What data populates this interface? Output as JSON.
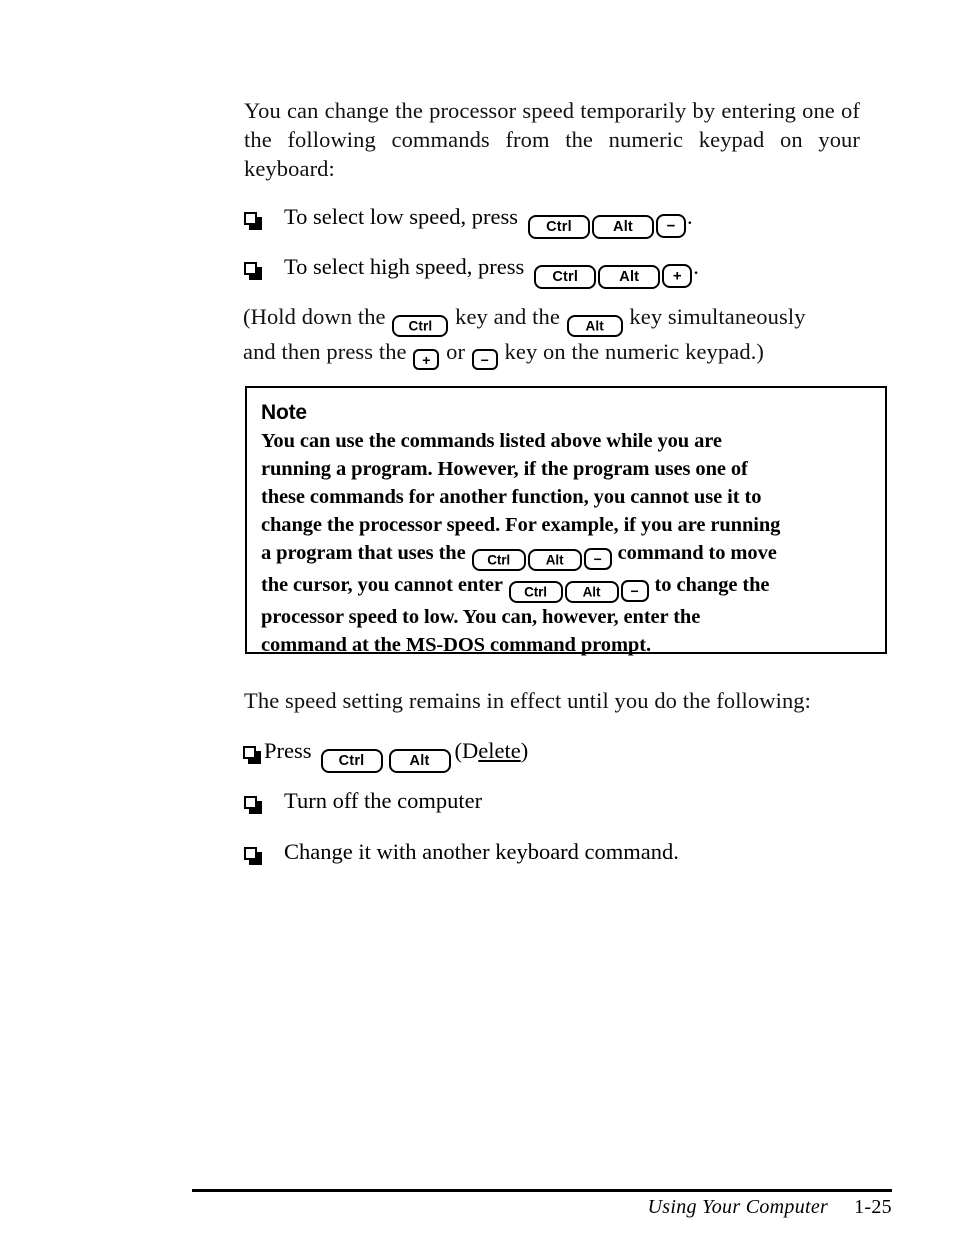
{
  "document": {
    "intro_paragraph": "You can change the processor speed temporarily by entering one of the following commands from the numeric keypad on your keyboard:",
    "speed_bullets": [
      {
        "bullet_glyph": "square-bullet",
        "text_before": "To select low speed, press",
        "keys": [
          "Ctrl",
          "Alt",
          "−"
        ],
        "text_after": "."
      },
      {
        "bullet_glyph": "square-bullet",
        "text_before": "To select high speed, press",
        "keys": [
          "Ctrl",
          "Alt",
          "+"
        ],
        "text_after": "."
      }
    ],
    "hold_paragraph": {
      "line1_part1": "(Hold down the",
      "line1_key1": "Ctrl",
      "line1_part2": "key and the",
      "line1_key2": "Alt",
      "line1_part3": "key simultaneously",
      "line2_part1": "and then press the",
      "line2_key1": "+",
      "line2_part2": "or",
      "line2_key2": "−",
      "line2_part3": "key on the numeric keypad.)"
    },
    "note": {
      "title": "Note",
      "line1": "You can use the commands listed above while you are",
      "line2": "running a program. However, if the program uses one of",
      "line3": "these commands for another function, you cannot use it to",
      "line4": "change the processor speed. For example, if you are running",
      "line5_part1": "a program that uses the",
      "line5_keys": [
        "Ctrl",
        "Alt",
        "−"
      ],
      "line5_part2": "command to move",
      "line6_part1": "the cursor, you cannot enter",
      "line6_keys": [
        "Ctrl",
        "Alt",
        "−"
      ],
      "line6_part2": "to change the",
      "line7": "processor speed to low. You can, however, enter the",
      "line8": "command at the MS-DOS command prompt."
    },
    "remains_paragraph": "The speed setting remains in effect until you do the following:",
    "reset_bullets": [
      {
        "bullet_glyph": "square-bullet",
        "text_before": "Press",
        "keys": [
          "Ctrl",
          "Alt"
        ],
        "text_after_prefix": "(D",
        "text_after_underlined": "elete",
        "text_after_suffix": ")"
      },
      {
        "bullet_glyph": "square-bullet",
        "text_before": "Turn off the computer",
        "keys": [],
        "text_after": ""
      },
      {
        "bullet_glyph": "square-bullet",
        "text_before": "Change it with another keyboard command.",
        "keys": [],
        "text_after": ""
      }
    ],
    "footer": {
      "chapter_title": "Using Your Computer",
      "page_number": "1-25"
    },
    "colors": {
      "ink": "#000000",
      "paper": "#ffffff"
    }
  }
}
